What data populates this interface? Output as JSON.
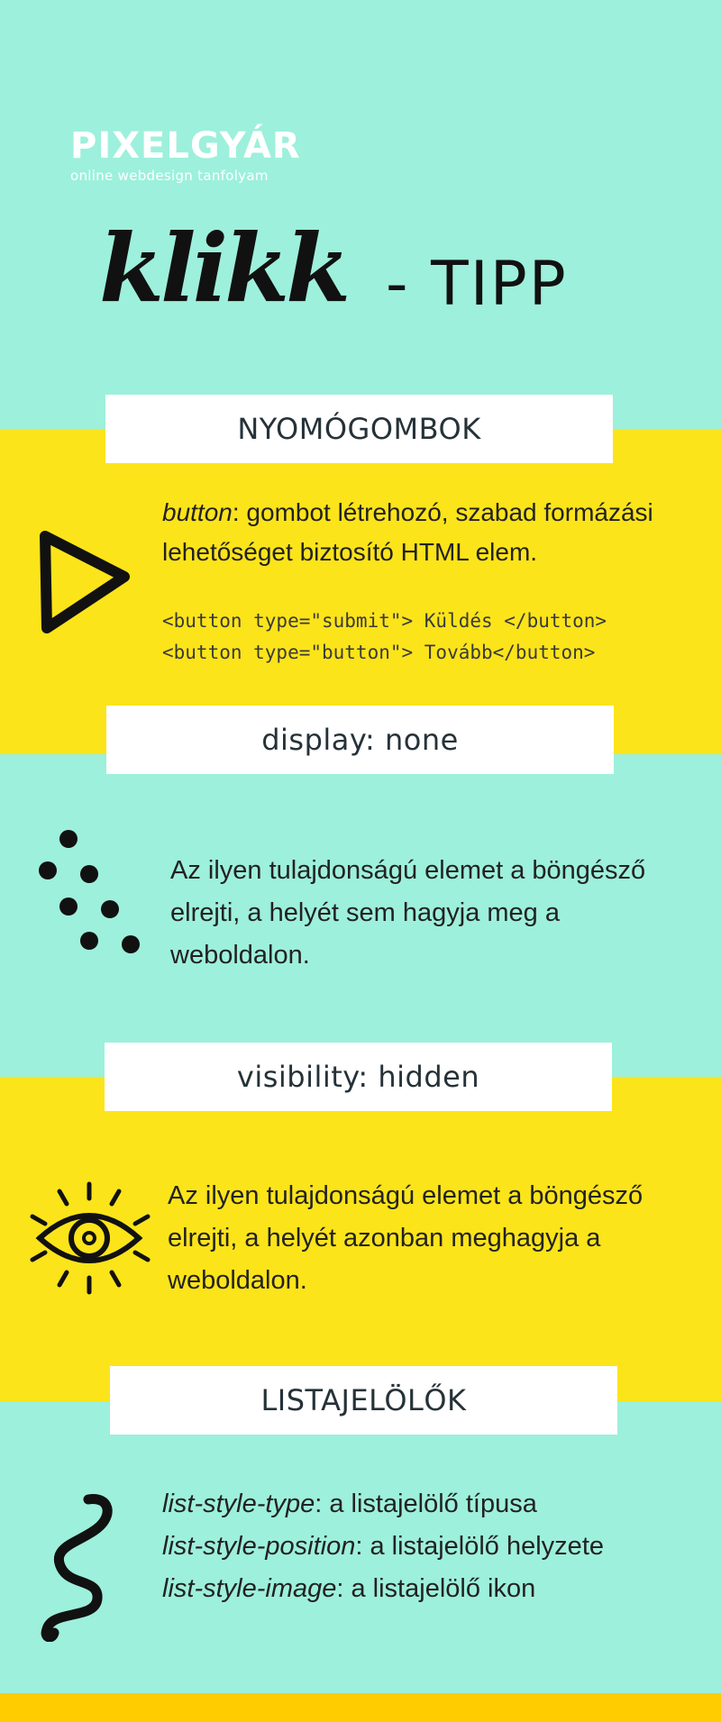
{
  "brand": {
    "name": "PIXELGYÁR",
    "subtitle": "online webdesign tanfolyam"
  },
  "hero": {
    "script_word": "klikk",
    "rest": "- TIPP"
  },
  "sections": [
    {
      "label": "NYOMÓGOMBOK",
      "icon": "triangle-play-icon",
      "term": "button",
      "desc_line1": ": gombot létrehozó, szabad formázási",
      "desc_line2": "lehetőséget biztosító HTML elem.",
      "code_line1": "<button type=\"submit\"> Küldés </button>",
      "code_line2": "<button type=\"button\"> Tovább</button>"
    },
    {
      "label": "display: none",
      "icon": "dots-icon",
      "line1": "Az ilyen tulajdonságú elemet a böngésző",
      "line2": "elrejti, a helyét sem hagyja meg a",
      "line3": "weboldalon."
    },
    {
      "label": "visibility: hidden",
      "icon": "eye-icon",
      "line1": "Az ilyen tulajdonságú elemet a böngésző",
      "line2": "elrejti, a helyét azonban meghagyja a",
      "line3": "weboldalon."
    },
    {
      "label": "LISTAJELÖLŐK",
      "icon": "squiggle-icon",
      "items": [
        {
          "term": "list-style-type",
          "desc": ": a listajelölő típusa"
        },
        {
          "term": "list-style-position",
          "desc": ": a listajelölő helyzete"
        },
        {
          "term": "list-style-image",
          "desc": ": a listajelölő ikon"
        }
      ]
    }
  ],
  "colors": {
    "mint": "#9df0dc",
    "yellow": "#fce41a",
    "gold": "#ffcc00",
    "white": "#ffffff",
    "ink": "#111111"
  }
}
